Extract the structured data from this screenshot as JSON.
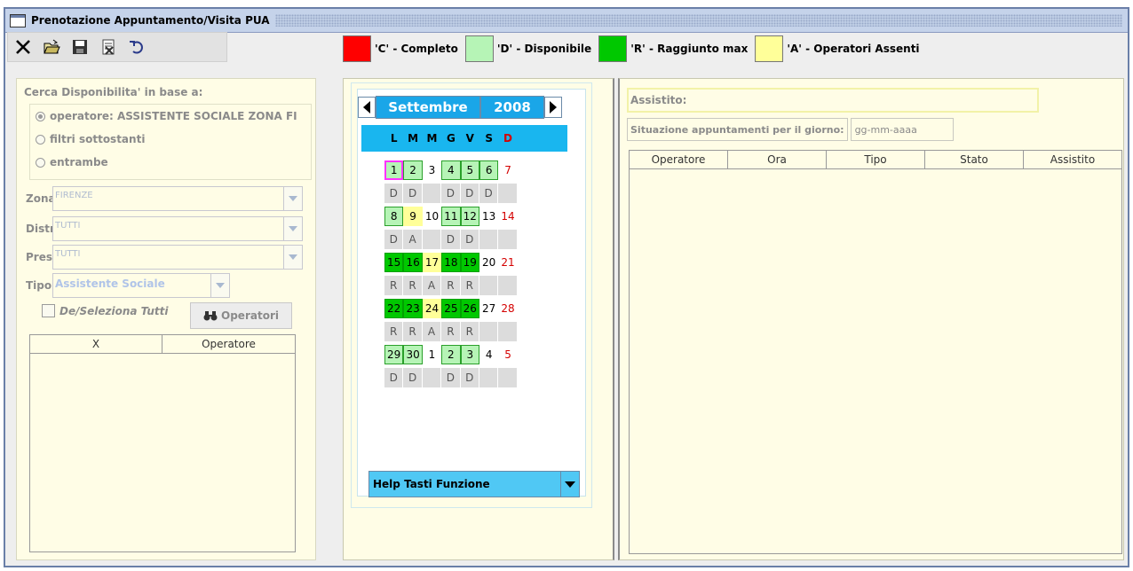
{
  "window": {
    "title": "Prenotazione Appuntamento/Visita PUA"
  },
  "toolbar": {
    "icons": [
      "close-icon",
      "open-folder-icon",
      "save-icon",
      "delete-icon",
      "undo-icon"
    ]
  },
  "legend": [
    {
      "label": "'C' - Completo",
      "color": "#ff0000"
    },
    {
      "label": "'D' - Disponibile",
      "color": "#b6f4b6"
    },
    {
      "label": "'R' - Raggiunto max",
      "color": "#00c800"
    },
    {
      "label": "'A' - Operatori Assenti",
      "color": "#ffff99"
    }
  ],
  "search": {
    "heading": "Cerca Disponibilita' in base a:",
    "options": [
      {
        "label": "operatore: ASSISTENTE SOCIALE ZONA FI",
        "checked": true
      },
      {
        "label": "filtri sottostanti",
        "checked": false
      },
      {
        "label": "entrambe",
        "checked": false
      }
    ],
    "zona": {
      "label": "Zona",
      "value": "FIRENZE"
    },
    "distr": {
      "label": "Distr",
      "value": "TUTTI"
    },
    "pres": {
      "label": "Pres",
      "value": "TUTTI"
    },
    "tipo": {
      "label": "Tipo",
      "value": "Assistente Sociale"
    },
    "select_all": "De/Seleziona Tutti",
    "operatori_button": "Operatori",
    "table_headers": [
      "X",
      "Operatore"
    ]
  },
  "calendar": {
    "month": "Settembre",
    "year": "2008",
    "day_names": [
      "L",
      "M",
      "M",
      "G",
      "V",
      "S",
      "D"
    ],
    "weeks": [
      {
        "days": [
          {
            "n": "1",
            "t": "d",
            "sel": true
          },
          {
            "n": "2",
            "t": "d"
          },
          {
            "n": "3",
            "t": "n"
          },
          {
            "n": "4",
            "t": "d"
          },
          {
            "n": "5",
            "t": "d"
          },
          {
            "n": "6",
            "t": "d"
          },
          {
            "n": "7",
            "t": "sun"
          }
        ],
        "status": [
          "D",
          "D",
          "",
          "D",
          "D",
          "D",
          ""
        ]
      },
      {
        "days": [
          {
            "n": "8",
            "t": "d"
          },
          {
            "n": "9",
            "t": "a"
          },
          {
            "n": "10",
            "t": "n"
          },
          {
            "n": "11",
            "t": "d"
          },
          {
            "n": "12",
            "t": "d"
          },
          {
            "n": "13",
            "t": "n"
          },
          {
            "n": "14",
            "t": "sun"
          }
        ],
        "status": [
          "D",
          "A",
          "",
          "D",
          "D",
          "",
          ""
        ]
      },
      {
        "days": [
          {
            "n": "15",
            "t": "r"
          },
          {
            "n": "16",
            "t": "r"
          },
          {
            "n": "17",
            "t": "a"
          },
          {
            "n": "18",
            "t": "r"
          },
          {
            "n": "19",
            "t": "r"
          },
          {
            "n": "20",
            "t": "n"
          },
          {
            "n": "21",
            "t": "sun"
          }
        ],
        "status": [
          "R",
          "R",
          "A",
          "R",
          "R",
          "",
          ""
        ]
      },
      {
        "days": [
          {
            "n": "22",
            "t": "r"
          },
          {
            "n": "23",
            "t": "r"
          },
          {
            "n": "24",
            "t": "a"
          },
          {
            "n": "25",
            "t": "r"
          },
          {
            "n": "26",
            "t": "r"
          },
          {
            "n": "27",
            "t": "n"
          },
          {
            "n": "28",
            "t": "sun"
          }
        ],
        "status": [
          "R",
          "R",
          "A",
          "R",
          "R",
          "",
          ""
        ]
      },
      {
        "days": [
          {
            "n": "29",
            "t": "d"
          },
          {
            "n": "30",
            "t": "d"
          },
          {
            "n": "1",
            "t": "n"
          },
          {
            "n": "2",
            "t": "d"
          },
          {
            "n": "3",
            "t": "d"
          },
          {
            "n": "4",
            "t": "n"
          },
          {
            "n": "5",
            "t": "sun"
          }
        ],
        "status": [
          "D",
          "D",
          "",
          "D",
          "D",
          "",
          ""
        ]
      }
    ],
    "help_label": "Help Tasti Funzione"
  },
  "appointments": {
    "assistito_label": "Assistito:",
    "situazione_label": "Situazione appuntamenti per il giorno:",
    "date_placeholder": "gg-mm-aaaa",
    "headers": [
      "Operatore",
      "Ora",
      "Tipo",
      "Stato",
      "Assistito"
    ]
  }
}
